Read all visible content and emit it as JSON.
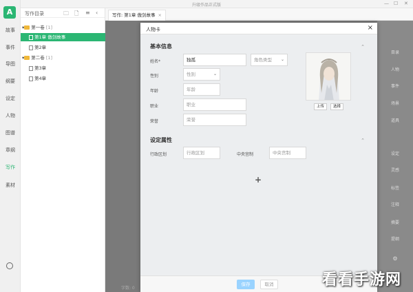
{
  "window": {
    "title": "升级作品正式版"
  },
  "sidebar": {
    "items": [
      {
        "label": "故事"
      },
      {
        "label": "事件"
      },
      {
        "label": "导图"
      },
      {
        "label": "纲要"
      },
      {
        "label": "设定"
      },
      {
        "label": "人物"
      },
      {
        "label": "图谱"
      },
      {
        "label": "章纲"
      },
      {
        "label": "写作"
      },
      {
        "label": "素材"
      }
    ],
    "active": "写作"
  },
  "tree": {
    "header": "写作目录",
    "rows": [
      {
        "label": "第一卷",
        "count": "[1]",
        "type": "volume"
      },
      {
        "label": "第1章 傲剑故事",
        "count": "",
        "type": "chapter"
      },
      {
        "label": "第2章",
        "count": "",
        "type": "chapter"
      },
      {
        "label": "第二卷",
        "count": "[1]",
        "type": "volume"
      },
      {
        "label": "第3章",
        "count": "",
        "type": "chapter"
      },
      {
        "label": "第4章",
        "count": "",
        "type": "chapter"
      }
    ]
  },
  "tab": {
    "label": "写作: 第1章 傲剑故事",
    "close": "×"
  },
  "right_panel": {
    "items": [
      {
        "label": "目录"
      },
      {
        "label": "人物"
      },
      {
        "label": "事件"
      },
      {
        "label": "场景"
      },
      {
        "label": "道具"
      },
      {
        "label": "设定"
      },
      {
        "label": "灵感"
      },
      {
        "label": "标签"
      },
      {
        "label": "注释"
      },
      {
        "label": "摘要"
      },
      {
        "label": "提纲"
      }
    ]
  },
  "modal": {
    "title": "人物卡",
    "close": "×",
    "basic_section": "基本信息",
    "name_label": "姓名*",
    "name_value": "独孤",
    "role_type_placeholder": "角色类型",
    "gender_label": "性别",
    "gender_placeholder": "性别",
    "age_label": "年龄",
    "age_placeholder": "年龄",
    "job_label": "职业",
    "job_placeholder": "职业",
    "honor_label": "荣誉",
    "honor_placeholder": "荣誉",
    "upload_label": "上传",
    "choose_label": "选择",
    "attr_section": "设定属性",
    "region_label": "行政区划",
    "region_placeholder": "行政区划",
    "central_label": "中央宫制",
    "central_placeholder": "中央宫制",
    "add_symbol": "+",
    "save_label": "保存",
    "cancel_label": "取消"
  },
  "watermark": "看看手游网"
}
